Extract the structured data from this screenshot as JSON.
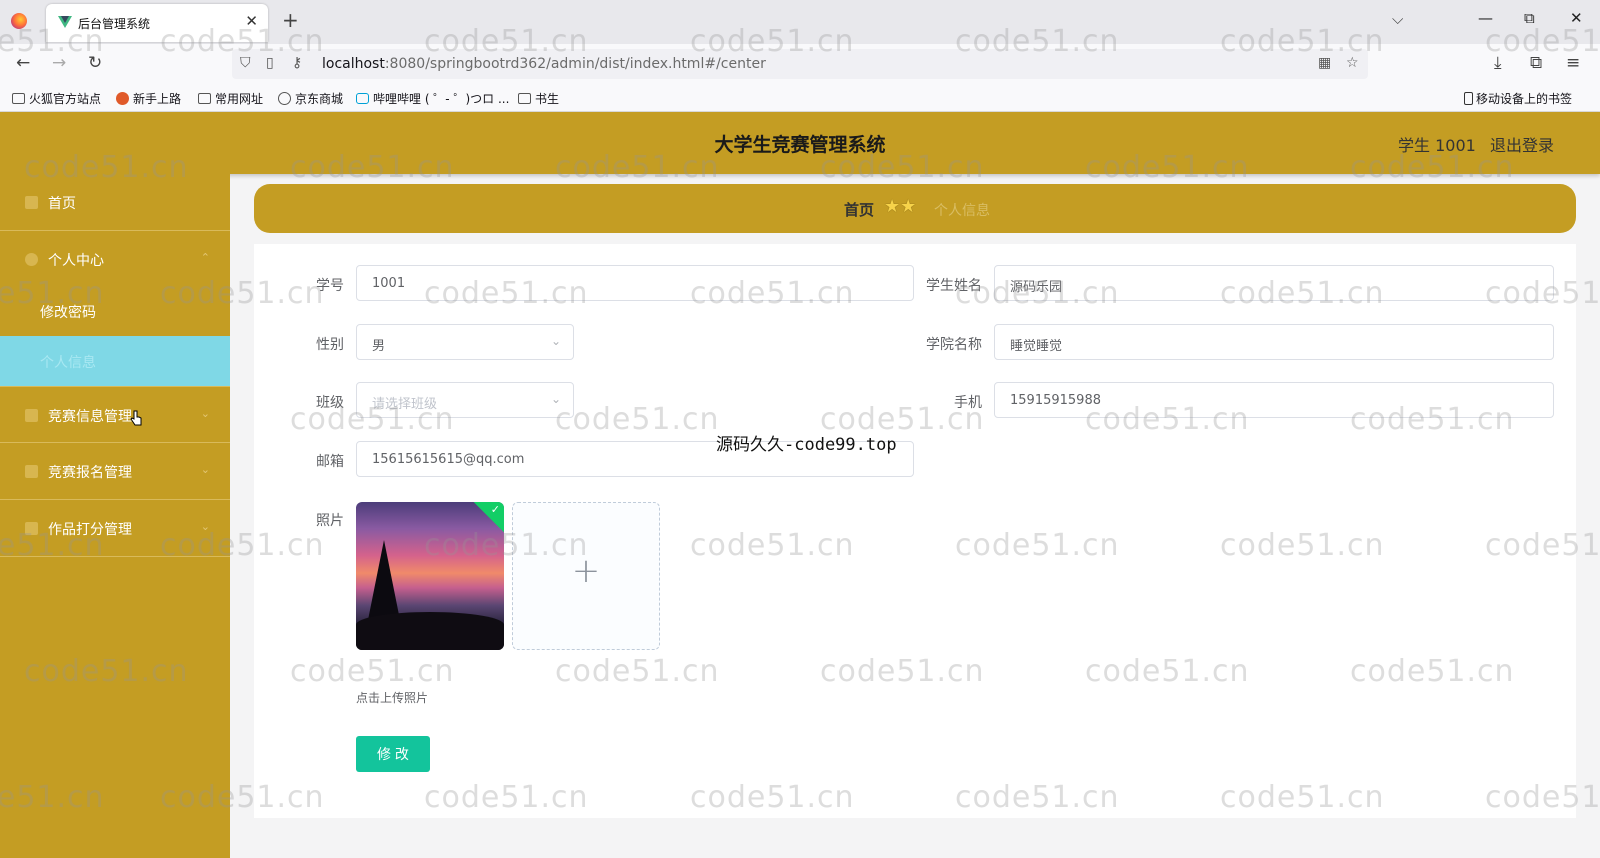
{
  "browser": {
    "tab_title": "后台管理系统",
    "tab_close": "✕",
    "new_tab": "+",
    "list_tabs": "⌵",
    "minimize": "—",
    "restore": "⧉",
    "close": "✕",
    "url_host": "localhost",
    "url_rest": ":8080/springbootrd362/admin/dist/index.html#/center",
    "bookmarks": [
      "火狐官方站点",
      "新手上路",
      "常用网址",
      "京东商城",
      "哔哩哔哩 ( ゜- ゜)つロ ...",
      "书生"
    ],
    "bookmarks_right": "移动设备上的书签",
    "icons": [
      "back-arrow-icon",
      "forward-arrow-icon",
      "reload-icon",
      "shield-icon",
      "page-icon",
      "key-icon",
      "qr-code-icon",
      "star-icon",
      "download-icon",
      "extensions-icon",
      "menu-icon"
    ]
  },
  "header": {
    "title": "大学生竞赛管理系统",
    "user": "学生 1001",
    "logout": "退出登录"
  },
  "sidebar": {
    "items": [
      {
        "label": "首页"
      },
      {
        "label": "个人中心"
      },
      {
        "label": "修改密码"
      },
      {
        "label": "个人信息"
      },
      {
        "label": "竞赛信息管理"
      },
      {
        "label": "竞赛报名管理"
      },
      {
        "label": "作品打分管理"
      }
    ]
  },
  "breadcrumb": {
    "home": "首页",
    "stars": "★★",
    "current": "个人信息"
  },
  "form": {
    "student_no_label": "学号",
    "student_no": "1001",
    "student_name_label": "学生姓名",
    "student_name": "源码乐园",
    "gender_label": "性别",
    "gender": "男",
    "college_label": "学院名称",
    "college": "睡觉睡觉",
    "class_label": "班级",
    "class_placeholder": "请选择班级",
    "phone_label": "手机",
    "phone": "15915915988",
    "email_label": "邮箱",
    "email": "15615615615@qq.com",
    "photo_label": "照片",
    "upload_tip": "点击上传照片",
    "submit": "修 改"
  },
  "overlay_text": "源码久久-code99.top",
  "watermark": "code51.cn",
  "colors": {
    "theme": "#c49d23",
    "active_menu": "#7fd8e6",
    "submit": "#13c49c"
  }
}
